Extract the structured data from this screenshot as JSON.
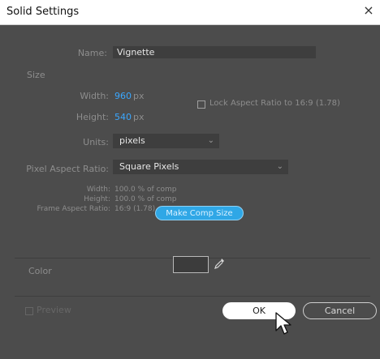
{
  "window": {
    "title": "Solid Settings",
    "close_glyph": "×"
  },
  "name": {
    "label": "Name:",
    "value": "Vignette"
  },
  "size": {
    "section_label": "Size",
    "width_label": "Width:",
    "width_value": "960",
    "height_label": "Height:",
    "height_value": "540",
    "unit": "px",
    "lock_aspect_label": "Lock Aspect Ratio to 16:9 (1.78)",
    "lock_aspect_checked": false,
    "units_label": "Units:",
    "units_value": "pixels",
    "par_label": "Pixel Aspect Ratio:",
    "par_value": "Square Pixels",
    "info_width_label": "Width:",
    "info_width_value": "100.0 % of comp",
    "info_height_label": "Height:",
    "info_height_value": "100.0 % of comp",
    "info_far_label": "Frame Aspect Ratio:",
    "info_far_value": "16:9 (1.78)",
    "make_comp_size_label": "Make Comp Size"
  },
  "color": {
    "section_label": "Color",
    "swatch_color": "#3c3c3c",
    "eyedropper_icon": "eyedropper-icon"
  },
  "footer": {
    "preview_label": "Preview",
    "ok_label": "OK",
    "cancel_label": "Cancel"
  },
  "colors": {
    "panel": "#4c4c4c",
    "field": "#3e3e3e",
    "accent_blue": "#2fa7e6",
    "value_blue": "#3aa7ff"
  }
}
